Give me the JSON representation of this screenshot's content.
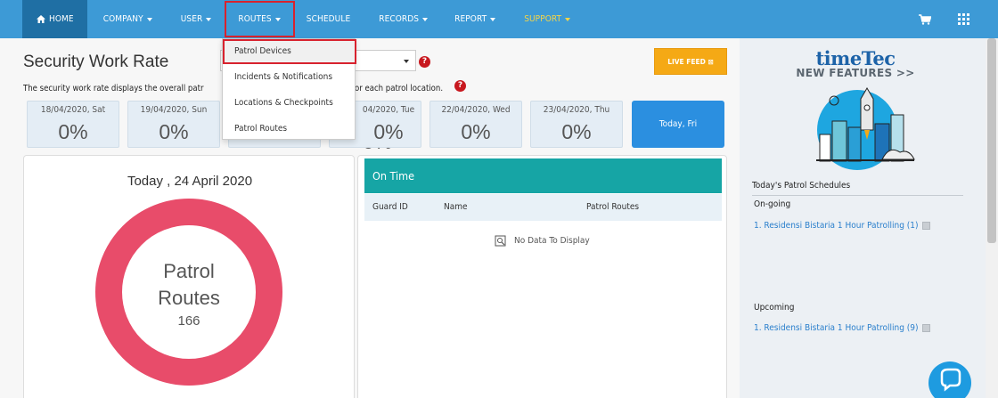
{
  "nav": {
    "items": [
      {
        "label": "HOME"
      },
      {
        "label": "COMPANY"
      },
      {
        "label": "USER"
      },
      {
        "label": "ROUTES"
      },
      {
        "label": "SCHEDULE"
      },
      {
        "label": "RECORDS"
      },
      {
        "label": "REPORT"
      },
      {
        "label": "SUPPORT"
      }
    ]
  },
  "page": {
    "title": "Security Work Rate",
    "description": "The security work rate displays the overall patr",
    "description_end": "or each patrol location.",
    "live_feed": "LIVE FEED"
  },
  "days": [
    {
      "label": "18/04/2020, Sat",
      "value": "0%"
    },
    {
      "label": "19/04/2020, Sun",
      "value": "0%"
    },
    {
      "label": "04/2020, Tue",
      "value": "0%"
    },
    {
      "label": "22/04/2020, Wed",
      "value": "0%"
    },
    {
      "label": "23/04/2020, Thu",
      "value": "0%"
    }
  ],
  "today_card": {
    "label": "Today, Fri"
  },
  "summary": {
    "date": "Today , 24 April 2020",
    "donut_title_1": "Patrol",
    "donut_title_2": "Routes",
    "donut_value": "166",
    "donut_color": "#e84c6a"
  },
  "ontime": {
    "title": "On Time",
    "columns": [
      "Guard ID",
      "Name",
      "Patrol Routes"
    ],
    "empty_text": "No Data To Display"
  },
  "dropdown": {
    "items": [
      "Patrol Devices",
      "Incidents & Notifications",
      "Locations & Checkpoints",
      "Patrol Routes"
    ]
  },
  "sidebar": {
    "logo_main": "timeTec",
    "logo_sub": "NEW FEATURES >>",
    "schedules_title": "Today's Patrol Schedules",
    "ongoing_label": "On-going",
    "ongoing_item": "1. Residensi Bistaria 1 Hour Patrolling (1)",
    "upcoming_label": "Upcoming",
    "upcoming_item": "1. Residensi Bistaria 1 Hour Patrolling (9)"
  },
  "colors": {
    "nav_bg": "#3d9ad6",
    "accent_red": "#d8222e",
    "today_blue": "#2b8fe0",
    "ontime_teal": "#16a5a5",
    "live_feed_orange": "#f5a915"
  }
}
